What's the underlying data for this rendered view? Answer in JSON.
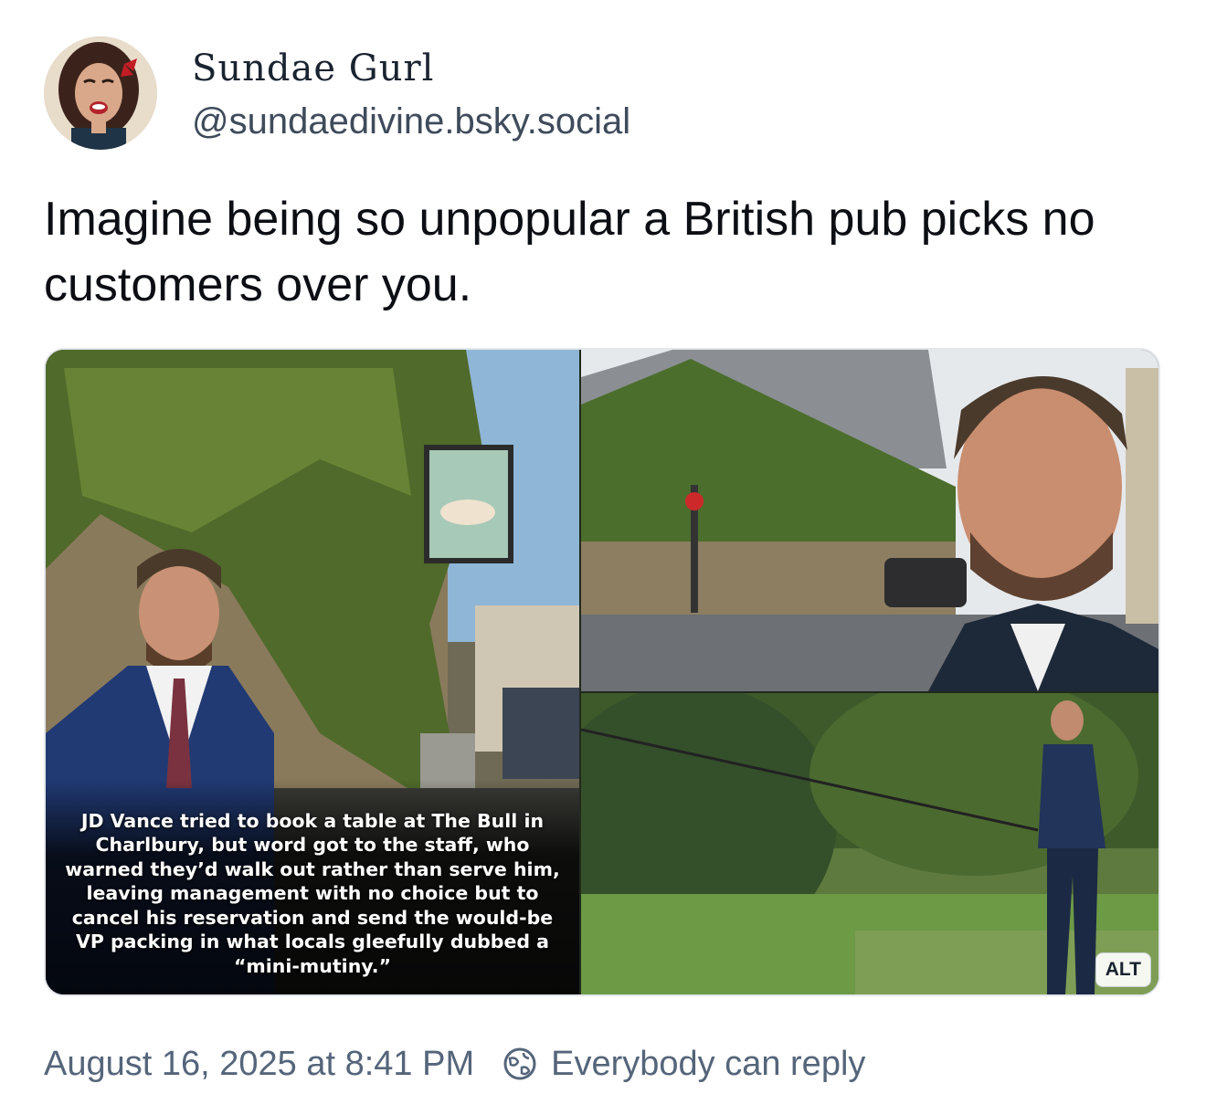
{
  "author": {
    "display_name": "Sundae Gurl",
    "handle": "@sundaedivine.bsky.social",
    "avatar_icon": "profile-photo"
  },
  "post": {
    "text": "Imagine being so unpopular a British pub picks no customers over you."
  },
  "media": {
    "caption": "JD Vance tried to book a table at The Bull in Charlbury, but word got to the staff, who warned they’d walk out rather than serve him, leaving management with no choice but to cancel his reservation and send the would-be VP packing in what locals gleefully dubbed a “mini-mutiny.”",
    "alt_badge": "ALT"
  },
  "footer": {
    "timestamp": "August 16, 2025 at 8:41 PM",
    "reply_setting": "Everybody can reply",
    "reply_icon": "globe-icon"
  },
  "colors": {
    "text_primary": "#0b0f14",
    "text_secondary": "#55657a",
    "border": "#e3e7ec"
  }
}
